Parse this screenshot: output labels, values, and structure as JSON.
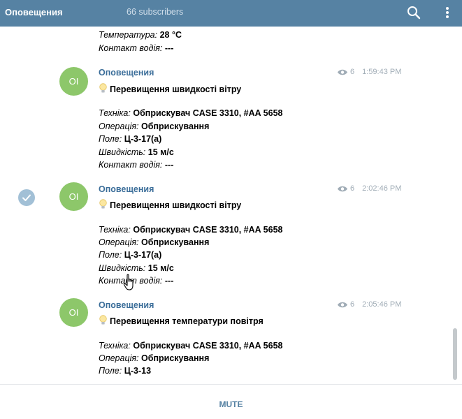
{
  "header": {
    "title": "Оповещения",
    "subscribers": "66 subscribers"
  },
  "top_partial": [
    {
      "key": "Температура:",
      "value": "28 °C"
    },
    {
      "key": "Контакт водія:",
      "value": "---"
    }
  ],
  "messages": [
    {
      "avatar": "OI",
      "sender": "Оповещения",
      "views": "6",
      "time": "1:59:43 PM",
      "headline": "Перевищення швидкості вітру",
      "fields": [
        {
          "key": "Техніка:",
          "value": "Обприскувач CASE 3310, #AA 5658"
        },
        {
          "key": "Операція:",
          "value": "Обприскування"
        },
        {
          "key": "Поле:",
          "value": "Ц-3-17(а)"
        },
        {
          "key": "Швидкість:",
          "value": "15 м/с"
        },
        {
          "key": "Контакт водія:",
          "value": "---"
        }
      ]
    },
    {
      "avatar": "OI",
      "sender": "Оповещения",
      "views": "6",
      "time": "2:02:46 PM",
      "headline": "Перевищення швидкості вітру",
      "fields": [
        {
          "key": "Техніка:",
          "value": "Обприскувач CASE 3310, #AA 5658"
        },
        {
          "key": "Операція:",
          "value": "Обприскування"
        },
        {
          "key": "Поле:",
          "value": "Ц-3-17(а)"
        },
        {
          "key": "Швидкість:",
          "value": "15 м/с"
        },
        {
          "key": "Контакт водія:",
          "value": "---"
        }
      ]
    },
    {
      "avatar": "OI",
      "sender": "Оповещения",
      "views": "6",
      "time": "2:05:46 PM",
      "headline": "Перевищення температури повітря",
      "fields": [
        {
          "key": "Техніка:",
          "value": "Обприскувач CASE 3310, #AA 5658"
        },
        {
          "key": "Операція:",
          "value": "Обприскування"
        },
        {
          "key": "Поле:",
          "value": "Ц-3-13"
        }
      ]
    }
  ],
  "footer": {
    "mute_label": "MUTE"
  },
  "colors": {
    "header_bg": "#5682a3",
    "sender": "#3a6d99",
    "avatar_bg": "#8dc76a",
    "meta": "#a0acb6"
  },
  "icons": [
    "search-icon",
    "more-vertical-icon",
    "eye-icon",
    "lightbulb-icon",
    "check-icon",
    "hand-cursor-icon"
  ]
}
